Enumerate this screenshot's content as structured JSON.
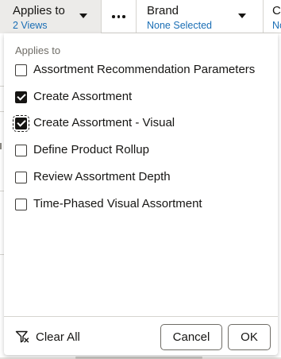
{
  "filter_bar": {
    "applies_to": {
      "title": "Applies to",
      "value": "2 Views"
    },
    "brand": {
      "title": "Brand",
      "value": "None Selected"
    },
    "col": {
      "title": "Col",
      "value": "None"
    }
  },
  "popup": {
    "header": "Applies to",
    "options": [
      {
        "label": "Assortment Recommendation Parameters",
        "checked": false
      },
      {
        "label": "Create Assortment",
        "checked": true
      },
      {
        "label": "Create Assortment - Visual",
        "checked": true
      },
      {
        "label": "Define Product Rollup",
        "checked": false
      },
      {
        "label": "Review Assortment Depth",
        "checked": false
      },
      {
        "label": "Time-Phased Visual Assortment",
        "checked": false
      }
    ],
    "clear_all_label": "Clear All",
    "cancel_label": "Cancel",
    "ok_label": "OK"
  },
  "icons": {
    "more": "ellipsis-icon",
    "dropdown": "caret-down-icon",
    "clear_filter": "filter-clear-icon",
    "checkbox_checked": "checkbox-checked-icon",
    "checkbox_unchecked": "checkbox-unchecked-icon"
  },
  "colors": {
    "link_blue": "#1a6eb5",
    "text": "#161513",
    "selected_chip_bg": "#ecebe9"
  }
}
